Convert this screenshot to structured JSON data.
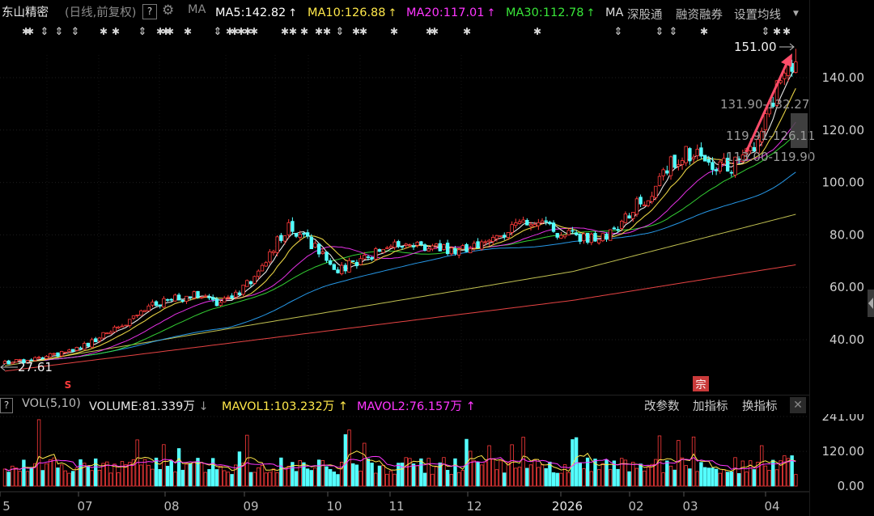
{
  "header": {
    "stock_name": "东山精密",
    "mode": "(日线,前复权)",
    "help_label": "?",
    "ma_label": "MA",
    "ma_items": [
      {
        "label": "MA5:142.82",
        "color": "#ffffff"
      },
      {
        "label": "MA10:126.88",
        "color": "#ffe84a"
      },
      {
        "label": "MA20:117.01",
        "color": "#ff36ff"
      },
      {
        "label": "MA30:112.78",
        "color": "#39e639"
      },
      {
        "label": "MA",
        "color": "#dddddd"
      }
    ],
    "tools": [
      "深股通",
      "融资融券",
      "设置均线"
    ]
  },
  "main_chart": {
    "y_ticks": [
      "140.00",
      "120.00",
      "100.00",
      "80.00",
      "60.00",
      "40.00"
    ],
    "high_label": "151.00",
    "low_label": "27.61",
    "range_labels": [
      "131.90-132.27",
      "119.91-126.11",
      "113.00-119.90"
    ],
    "s_marker": "S",
    "zong_marker": "宗",
    "star_marker": "✱",
    "up_marker": "⇕"
  },
  "volume": {
    "help_label": "?",
    "name": "VOL(5,10)",
    "volume_label": "VOLUME:81.339万",
    "mavol1_label": "MAVOL1:103.232万",
    "mavol2_label": "MAVOL2:76.157万",
    "buttons": [
      "改参数",
      "加指标",
      "换指标"
    ],
    "close_label": "✕",
    "y_ticks": [
      "241.00",
      "120.00",
      "0.00"
    ]
  },
  "x_axis": {
    "labels": [
      "5",
      "07",
      "08",
      "09",
      "10",
      "11",
      "12",
      "2026",
      "02",
      "03",
      "04"
    ]
  },
  "colors": {
    "up": "#ff3b3b",
    "down": "#54ffff",
    "ma5": "#ffffff",
    "ma10": "#ffe84a",
    "ma20": "#ff36ff",
    "ma30": "#39e639",
    "ma60": "#2aa7ff",
    "ma120": "#d6d65a",
    "ma250": "#ff4a4a",
    "annotation_arrow": "#ff4d6a"
  },
  "chart_data": {
    "type": "candlestick",
    "x_period_labels": [
      "5",
      "07",
      "08",
      "09",
      "10",
      "11",
      "12",
      "2026",
      "02",
      "03",
      "04"
    ],
    "ylim": [
      25,
      155
    ],
    "close_path": [
      [
        0,
        31
      ],
      [
        10,
        33
      ],
      [
        20,
        37
      ],
      [
        30,
        45
      ],
      [
        40,
        54
      ],
      [
        50,
        57
      ],
      [
        55,
        54
      ],
      [
        60,
        55
      ],
      [
        67,
        66
      ],
      [
        75,
        84
      ],
      [
        78,
        80
      ],
      [
        84,
        73
      ],
      [
        88,
        66
      ],
      [
        96,
        72
      ],
      [
        104,
        76
      ],
      [
        110,
        76
      ],
      [
        115,
        75
      ],
      [
        122,
        74
      ],
      [
        130,
        80
      ],
      [
        140,
        86
      ],
      [
        144,
        82
      ],
      [
        152,
        79
      ],
      [
        160,
        80
      ],
      [
        166,
        90
      ],
      [
        172,
        98
      ],
      [
        176,
        108
      ],
      [
        182,
        112
      ],
      [
        186,
        108
      ],
      [
        192,
        106
      ],
      [
        197,
        112
      ],
      [
        202,
        128
      ],
      [
        206,
        142
      ],
      [
        209,
        145
      ]
    ],
    "high": 151.0,
    "low": 27.61,
    "volume_ylim": [
      0,
      241
    ]
  }
}
